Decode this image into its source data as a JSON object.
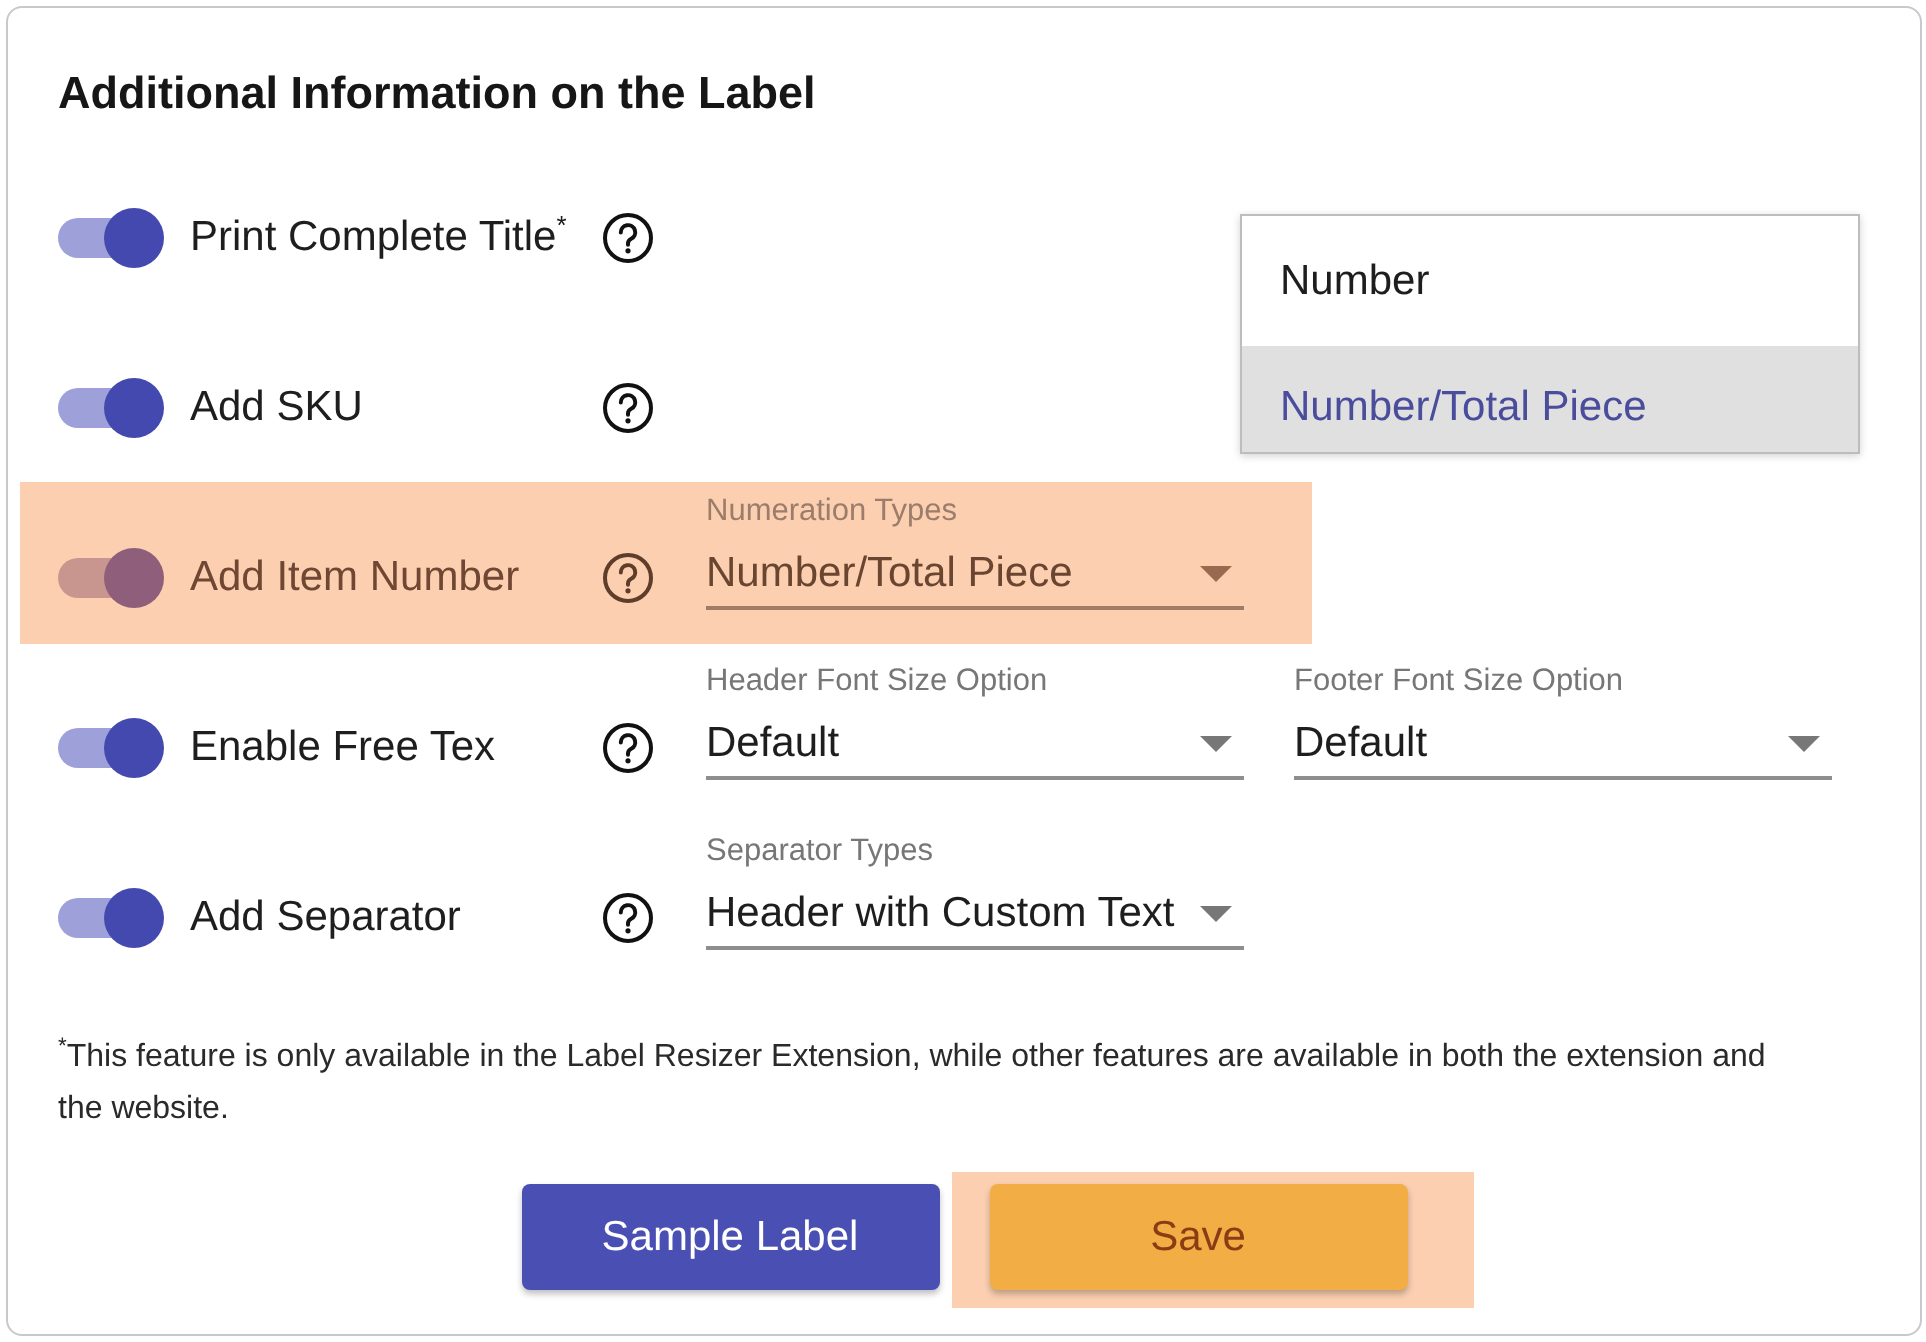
{
  "panel": {
    "title": "Additional Information on the Label"
  },
  "options": [
    {
      "label": "Print Complete Title$^{*}$",
      "on": true,
      "highlighted": false
    },
    {
      "label": "Add SKU",
      "on": true,
      "highlighted": false
    },
    {
      "label": "Add Item Number",
      "on": true,
      "highlighted": true,
      "selects": [
        {
          "label": "Numeration Types",
          "value": "Number/Total Piece",
          "menu": [
            {
              "label": "Number",
              "selected": false
            },
            {
              "label": "Number/Total Piece",
              "selected": true
            }
          ]
        }
      ]
    },
    {
      "label": "Enable Free Tex",
      "on": true,
      "highlighted": false,
      "selects": [
        {
          "label": "Header Font Size Option",
          "value": "Default"
        },
        {
          "label": "Footer Font Size Option",
          "value": "Default"
        }
      ]
    },
    {
      "label": "Add Separator",
      "on": true,
      "highlighted": false,
      "selects": [
        {
          "label": "Separator Types",
          "value": "Header with Custom Text"
        }
      ]
    }
  ],
  "footnote": "$^{*}$This feature is only available in the Label Resizer Extension, while other features are available in both the extension and the website.",
  "buttons": [
    {
      "label": "Sample Label",
      "kind": "primary",
      "highlighted": false
    },
    {
      "label": "Save",
      "kind": "accent",
      "highlighted": true
    }
  ]
}
